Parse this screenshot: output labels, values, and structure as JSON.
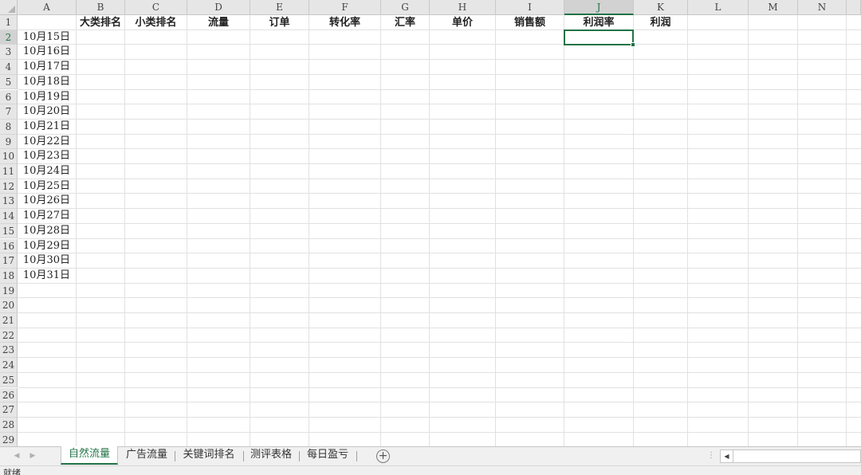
{
  "columns": [
    "A",
    "B",
    "C",
    "D",
    "E",
    "F",
    "G",
    "H",
    "I",
    "J",
    "K",
    "L",
    "M",
    "N"
  ],
  "selected_column": "J",
  "rows": [
    "1",
    "2",
    "3",
    "4",
    "5",
    "6",
    "7",
    "8",
    "9",
    "10",
    "11",
    "12",
    "13",
    "14",
    "15",
    "16",
    "17",
    "18",
    "19",
    "20",
    "21",
    "22",
    "23",
    "24",
    "25",
    "26",
    "27",
    "28",
    "29"
  ],
  "selected_row": "2",
  "header_row": {
    "B": "大类排名",
    "C": "小类排名",
    "D": "流量",
    "E": "订单",
    "F": "转化率",
    "G": "汇率",
    "H": "单价",
    "I": "销售额",
    "J": "利润率",
    "K": "利润"
  },
  "dates": [
    "10月15日",
    "10月16日",
    "10月17日",
    "10月18日",
    "10月19日",
    "10月20日",
    "10月21日",
    "10月22日",
    "10月23日",
    "10月24日",
    "10月25日",
    "10月26日",
    "10月27日",
    "10月28日",
    "10月29日",
    "10月30日",
    "10月31日"
  ],
  "active_cell": "J2",
  "sheet_tabs": [
    "自然流量",
    "广告流量",
    "关键词排名",
    "测评表格",
    "每日盈亏"
  ],
  "active_tab": "自然流量",
  "add_sheet_symbol": "+",
  "status": "就绪",
  "colors": {
    "accent": "#217346",
    "header_bg": "#e6e6e6",
    "grid": "#e1e1e1"
  }
}
